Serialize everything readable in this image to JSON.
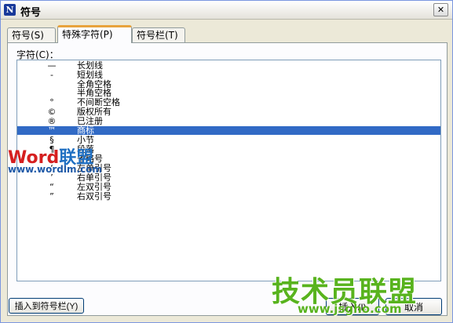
{
  "window": {
    "title": "符号",
    "app_icon": "N"
  },
  "tabs": [
    {
      "label": "符号(S)",
      "active": false
    },
    {
      "label": "特殊字符(P)",
      "active": true
    },
    {
      "label": "符号栏(T)",
      "active": false
    }
  ],
  "list_label": "字符(C)：",
  "rows": [
    {
      "char": "—",
      "name": "长划线"
    },
    {
      "char": "-",
      "name": "短划线"
    },
    {
      "char": "",
      "name": "全角空格"
    },
    {
      "char": "",
      "name": "半角空格"
    },
    {
      "char": "°",
      "name": "不间断空格"
    },
    {
      "char": "©",
      "name": "版权所有"
    },
    {
      "char": "®",
      "name": "已注册"
    },
    {
      "char": "™",
      "name": "商标"
    },
    {
      "char": "§",
      "name": "小节"
    },
    {
      "char": "¶",
      "name": "段落"
    },
    {
      "char": "…",
      "name": "省略号"
    },
    {
      "char": "‘",
      "name": "左单引号"
    },
    {
      "char": "’",
      "name": "右单引号"
    },
    {
      "char": "“",
      "name": "左双引号"
    },
    {
      "char": "”",
      "name": "右双引号"
    }
  ],
  "selected_index": 7,
  "buttons": {
    "insert_to_bar": "插入到符号栏(Y)",
    "insert": "插入(I)",
    "cancel": "取消"
  },
  "watermarks": {
    "word_a": "Word",
    "word_b": "联盟",
    "word_site": "www.wordlm.com",
    "jsg_name": "技术员联盟",
    "jsg_url": "www.jsgho.com"
  },
  "colors": {
    "selection": "#316ac5",
    "tab_accent": "#e8a33c",
    "dialog_bg": "#ece9d8"
  }
}
